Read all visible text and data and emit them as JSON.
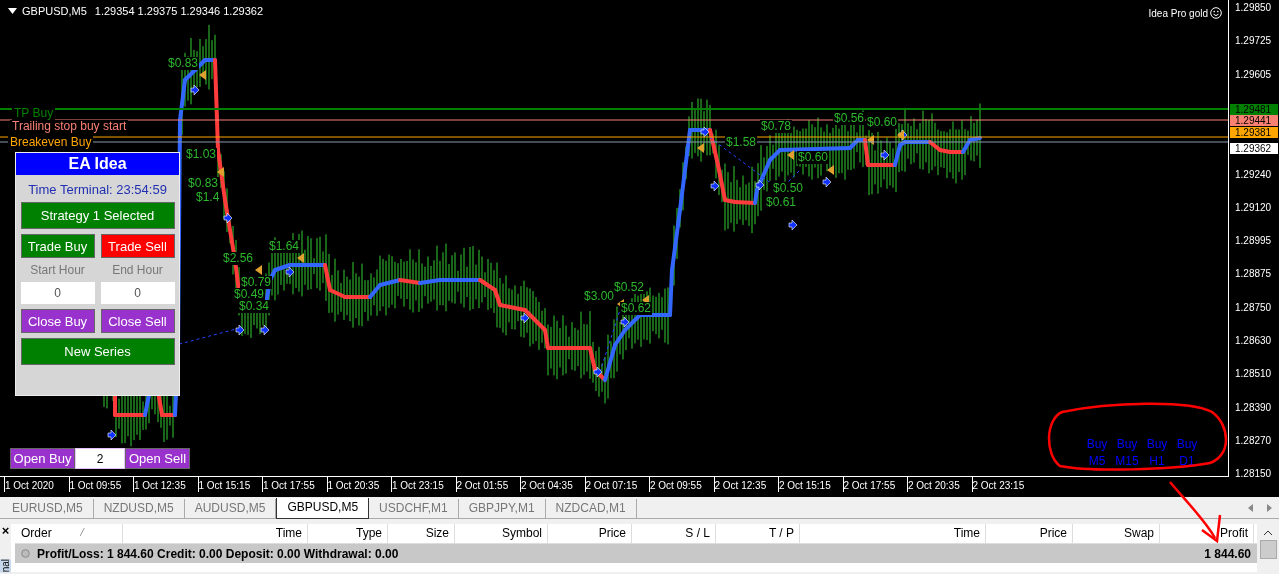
{
  "chart": {
    "symbol": "GBPUSD,M5",
    "quotes": "1.29354 1.29375 1.29346 1.29362",
    "indicator": "Idea Pro gold",
    "price_axis": [
      "1.29850",
      "1.29725",
      "1.29605",
      "1.29240",
      "1.29120",
      "1.28995",
      "1.28875",
      "1.28750",
      "1.28630",
      "1.28510",
      "1.28390",
      "1.28270",
      "1.28150"
    ],
    "price_tags": [
      {
        "text": "1.29481",
        "color": "#008000"
      },
      {
        "text": "1.29441",
        "color": "#fa8072"
      },
      {
        "text": "1.29381",
        "color": "#ffa500"
      },
      {
        "text": "1.29362",
        "color": "#ffffff"
      }
    ],
    "time_axis": [
      "1 Oct 2020",
      "1 Oct 09:55",
      "1 Oct 12:35",
      "1 Oct 15:15",
      "1 Oct 17:55",
      "1 Oct 20:35",
      "1 Oct 23:15",
      "2 Oct 01:55",
      "2 Oct 04:35",
      "2 Oct 07:15",
      "2 Oct 09:55",
      "2 Oct 12:35",
      "2 Oct 15:15",
      "2 Oct 17:55",
      "2 Oct 20:35",
      "2 Oct 23:15"
    ],
    "line_labels": [
      {
        "text": "TP Buy",
        "color": "#008000"
      },
      {
        "text": "Trailing stop buy start",
        "color": "#fa8072"
      },
      {
        "text": "Breakeven Buy",
        "color": "#ffa500"
      }
    ],
    "trade_labels": [
      "$0.83",
      "$1.03",
      "$0.83",
      "$1.4",
      "$1.64",
      "$2.56",
      "$0.79",
      "$0.49",
      "$0.34",
      "$3.00",
      "$0.62",
      "$0.52",
      "$1.58",
      "$0.78",
      "$0.60",
      "$0.50",
      "$0.61",
      "$0.56",
      "$0.60"
    ],
    "signals": [
      [
        "Buy",
        "Buy",
        "Buy",
        "Buy"
      ],
      [
        "M5",
        "M15",
        "H1",
        "D1"
      ]
    ]
  },
  "ea_panel": {
    "title": "EA Idea",
    "clock": "Time Terminal: 23:54:59",
    "strategy": "Strategy 1 Selected",
    "trade_buy": "Trade Buy",
    "trade_sell": "Trade Sell",
    "start_hour_label": "Start Hour",
    "end_hour_label": "End Hour",
    "start_hour": "0",
    "end_hour": "0",
    "close_buy": "Close Buy",
    "close_sell": "Close Sell",
    "new_series": "New Series"
  },
  "order_bar": {
    "open_buy": "Open Buy",
    "lots": "2",
    "open_sell": "Open Sell"
  },
  "tabs": [
    {
      "label": "EURUSD,M5",
      "selected": false
    },
    {
      "label": "NZDUSD,M5",
      "selected": false
    },
    {
      "label": "AUDUSD,M5",
      "selected": false
    },
    {
      "label": "GBPUSD,M5",
      "selected": true
    },
    {
      "label": "USDCHF,M1",
      "selected": false
    },
    {
      "label": "GBPJPY,M1",
      "selected": false
    },
    {
      "label": "NZDCAD,M1",
      "selected": false
    }
  ],
  "terminal": {
    "side_tab": "nal",
    "close": "×",
    "sort_mark": "⁄",
    "columns": [
      "Order",
      "Time",
      "Type",
      "Size",
      "Symbol",
      "Price",
      "S / L",
      "T / P",
      "Time",
      "Price",
      "Swap",
      "Profit"
    ],
    "summary": "Profit/Loss: 1 844.60  Credit: 0.00  Deposit: 0.00  Withdrawal: 0.00",
    "profit": "1 844.60"
  }
}
